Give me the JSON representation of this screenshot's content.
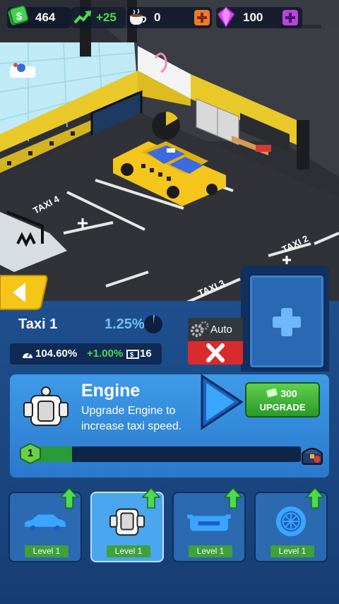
{
  "hud": {
    "cash": "464",
    "income_rate": "+25",
    "coffee": "0",
    "gems": "100",
    "colors": {
      "cash": "#3fd14a",
      "coffee_plus": "#ee7a2a",
      "gem": "#d34bf0",
      "gem_plus": "#b645d8"
    }
  },
  "scene": {
    "parking_labels": [
      "TAXI 4",
      "TAXI 3",
      "TAXI 2"
    ]
  },
  "taxi": {
    "name": "Taxi 1",
    "percent": "1.25%",
    "speed_stat": "104.60%",
    "speed_bonus": "+1.00%",
    "fare": "16"
  },
  "auto": {
    "label": "Auto"
  },
  "upgrade": {
    "title": "Engine",
    "description": "Upgrade Engine to increase taxi speed.",
    "price": "300",
    "button_label": "UPGRADE",
    "level": "1",
    "progress": 0.16
  },
  "tabs": [
    {
      "icon": "car-body-icon",
      "level": "Level 1"
    },
    {
      "icon": "engine-icon",
      "level": "Level 1"
    },
    {
      "icon": "bumper-icon",
      "level": "Level 1"
    },
    {
      "icon": "wheel-icon",
      "level": "Level 1"
    }
  ],
  "colors": {
    "accent": "#3e9be8",
    "upgrade_green": "#3fb83a",
    "close_red": "#d92b2b"
  }
}
